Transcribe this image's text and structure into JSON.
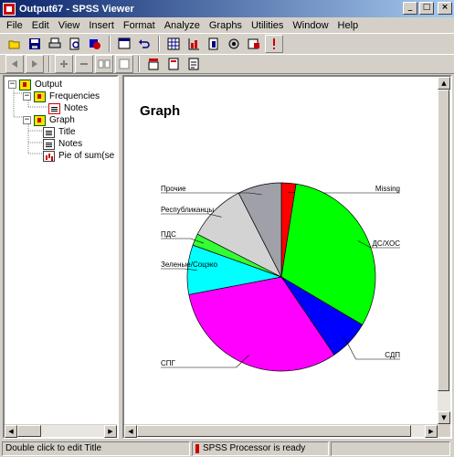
{
  "window": {
    "title": "Output67 - SPSS Viewer",
    "controls": [
      "_",
      "□",
      "×"
    ]
  },
  "menu": [
    "File",
    "Edit",
    "View",
    "Insert",
    "Format",
    "Analyze",
    "Graphs",
    "Utilities",
    "Window",
    "Help"
  ],
  "toolbar1": [
    "open-icon",
    "save-icon",
    "print-icon",
    "print-preview-icon",
    "export-icon",
    "recall-dialog-icon",
    "undo-icon",
    "goto-data-icon",
    "goto-case-icon",
    "variables-icon",
    "find-icon",
    "use-sets-icon",
    "select-cases-icon",
    "designate-window-icon"
  ],
  "toolbar2": [
    "promote-icon",
    "demote-icon",
    "expand-icon",
    "collapse-icon",
    "show-icon",
    "hide-icon",
    "insert-heading-icon",
    "insert-title-icon",
    "insert-text-icon"
  ],
  "outline": {
    "items": [
      {
        "label": "Output",
        "level": 0,
        "expander": "−",
        "icon": "book"
      },
      {
        "label": "Frequencies",
        "level": 1,
        "expander": "−",
        "icon": "book"
      },
      {
        "label": "Notes",
        "level": 2,
        "expander": "",
        "icon": "note-red"
      },
      {
        "label": "Graph",
        "level": 1,
        "expander": "−",
        "icon": "book"
      },
      {
        "label": "Title",
        "level": 2,
        "expander": "",
        "icon": "note"
      },
      {
        "label": "Notes",
        "level": 2,
        "expander": "",
        "icon": "note"
      },
      {
        "label": "Pie of sum(se",
        "level": 2,
        "expander": "",
        "icon": "pie"
      }
    ]
  },
  "content": {
    "heading": "Graph"
  },
  "chart_data": {
    "type": "pie",
    "title": "",
    "slices": [
      {
        "label": "Missing",
        "value": 2.5,
        "color": "#ff0000"
      },
      {
        "label": "ДС/ХОС",
        "value": 31.0,
        "color": "#00ff00"
      },
      {
        "label": "СДП",
        "value": 7.0,
        "color": "#0000ff"
      },
      {
        "label": "СПГ",
        "value": 31.5,
        "color": "#ff00ff"
      },
      {
        "label": "Зеленые/Соцэко",
        "value": 8.5,
        "color": "#00ffff"
      },
      {
        "label": "ПДС",
        "value": 2.0,
        "color": "#33ff33"
      },
      {
        "label": "Республиканцы",
        "value": 10.0,
        "color": "#d3d3d3"
      },
      {
        "label": "Прочие",
        "value": 7.5,
        "color": "#a0a0a8"
      }
    ],
    "legend": "none",
    "start_angle_deg": 0,
    "direction": "clockwise"
  },
  "status": {
    "message": "Double click to edit Title",
    "processor": "SPSS Processor  is ready"
  }
}
